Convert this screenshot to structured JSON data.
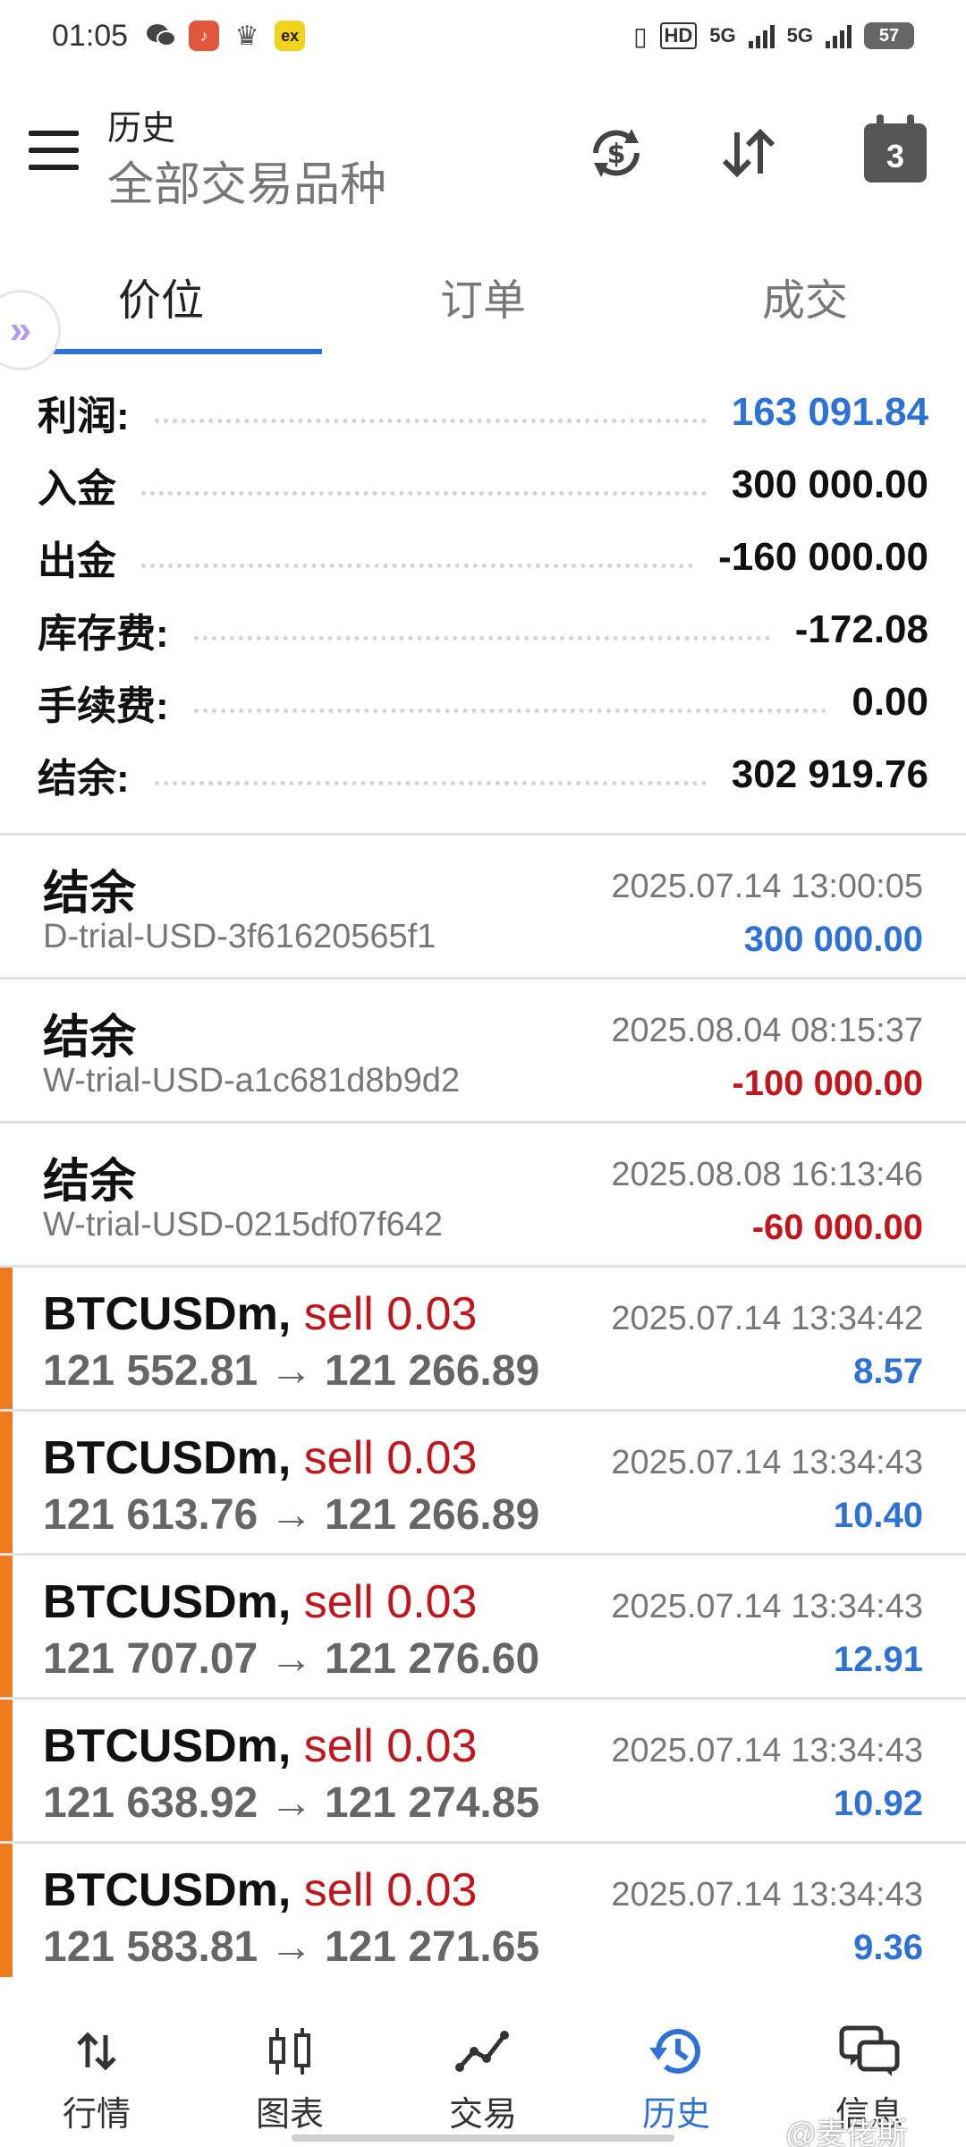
{
  "status_bar": {
    "time": "01:05",
    "network_hd": "HD",
    "network_5g_1": "5G",
    "network_5g_2": "5G",
    "battery": "57"
  },
  "header": {
    "title": "历史",
    "subtitle": "全部交易品种",
    "calendar_day": "3"
  },
  "tabs": [
    {
      "label": "价位",
      "active": true
    },
    {
      "label": "订单",
      "active": false
    },
    {
      "label": "成交",
      "active": false
    }
  ],
  "summary": [
    {
      "label": "利润:",
      "value": "163 091.84"
    },
    {
      "label": "入金",
      "value": "300 000.00"
    },
    {
      "label": "出金",
      "value": "-160 000.00"
    },
    {
      "label": "库存费:",
      "value": "-172.08"
    },
    {
      "label": "手续费:",
      "value": "0.00"
    },
    {
      "label": "结余:",
      "value": "302 919.76"
    }
  ],
  "balance_items": [
    {
      "title": "结余",
      "account": "D-trial-USD-3f61620565f1",
      "time": "2025.07.14 13:00:05",
      "amount": "300 000.00",
      "sign": "positive"
    },
    {
      "title": "结余",
      "account": "W-trial-USD-a1c681d8b9d2",
      "time": "2025.08.04 08:15:37",
      "amount": "-100 000.00",
      "sign": "negative"
    },
    {
      "title": "结余",
      "account": "W-trial-USD-0215df07f642",
      "time": "2025.08.08 16:13:46",
      "amount": "-60 000.00",
      "sign": "negative"
    }
  ],
  "trade_items": [
    {
      "symbol": "BTCUSDm,",
      "side": "sell 0.03",
      "prices": "121 552.81 → 121 266.89",
      "time": "2025.07.14 13:34:42",
      "profit": "8.57"
    },
    {
      "symbol": "BTCUSDm,",
      "side": "sell 0.03",
      "prices": "121 613.76 → 121 266.89",
      "time": "2025.07.14 13:34:43",
      "profit": "10.40"
    },
    {
      "symbol": "BTCUSDm,",
      "side": "sell 0.03",
      "prices": "121 707.07 → 121 276.60",
      "time": "2025.07.14 13:34:43",
      "profit": "12.91"
    },
    {
      "symbol": "BTCUSDm,",
      "side": "sell 0.03",
      "prices": "121 638.92 → 121 274.85",
      "time": "2025.07.14 13:34:43",
      "profit": "10.92"
    },
    {
      "symbol": "BTCUSDm,",
      "side": "sell 0.03",
      "prices": "121 583.81 → 121 271.65",
      "time": "2025.07.14 13:34:43",
      "profit": "9.36"
    }
  ],
  "bottom_nav": [
    {
      "label": "行情",
      "icon": "quotes-arrows-icon"
    },
    {
      "label": "图表",
      "icon": "candlestick-chart-icon"
    },
    {
      "label": "交易",
      "icon": "trade-line-icon"
    },
    {
      "label": "历史",
      "icon": "history-clock-icon",
      "active": true
    },
    {
      "label": "信息",
      "icon": "messages-icon"
    }
  ],
  "watermark": "@麦佬斯",
  "colors": {
    "accent_blue": "#2f72d6",
    "loss_red": "#c0161c",
    "trade_marker_orange": "#f07a1c"
  }
}
